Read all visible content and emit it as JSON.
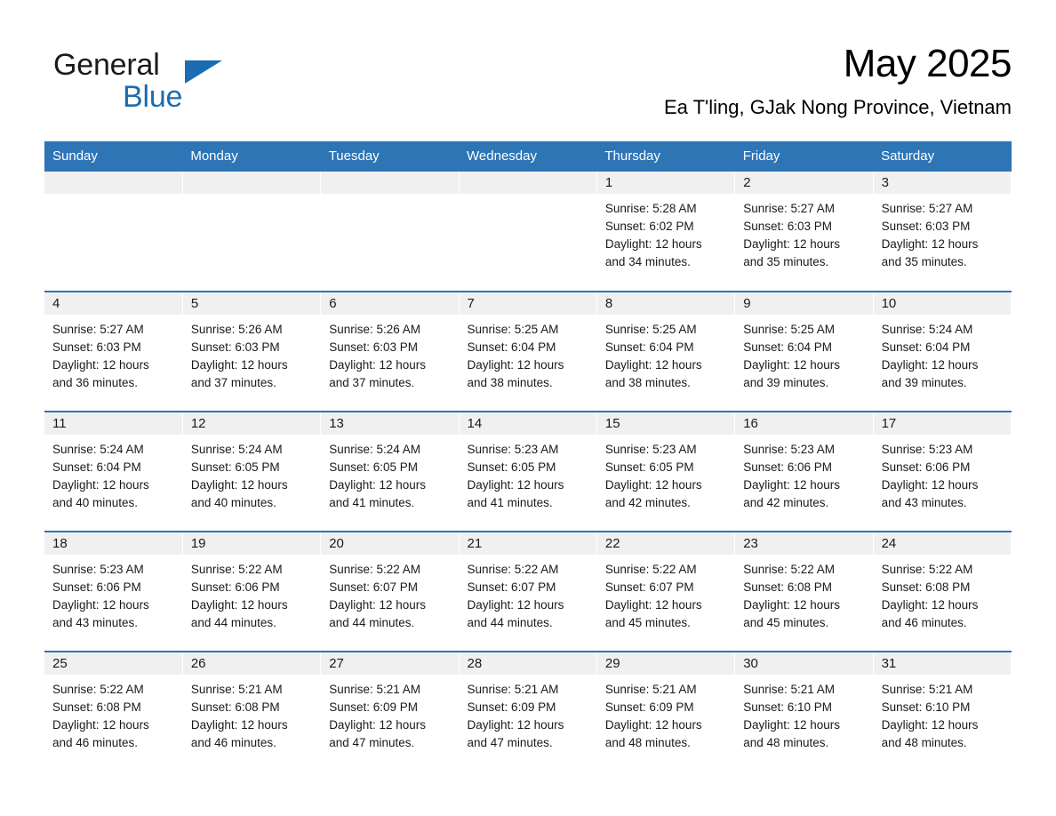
{
  "brand": {
    "name_part1": "General",
    "name_part2": "Blue",
    "triangle_icon": "triangle-right-icon",
    "accent_color": "#1b6cb0"
  },
  "header": {
    "title": "May 2025",
    "subtitle": "Ea T'ling, GJak Nong Province, Vietnam"
  },
  "calendar": {
    "header_bg": "#2e75b6",
    "daycell_header_bg": "#f0f0f0",
    "weekday_headers": [
      "Sunday",
      "Monday",
      "Tuesday",
      "Wednesday",
      "Thursday",
      "Friday",
      "Saturday"
    ],
    "weeks": [
      [
        {
          "day": "",
          "empty": true,
          "sunrise": "",
          "sunset": "",
          "daylight_line1": "",
          "daylight_line2": ""
        },
        {
          "day": "",
          "empty": true,
          "sunrise": "",
          "sunset": "",
          "daylight_line1": "",
          "daylight_line2": ""
        },
        {
          "day": "",
          "empty": true,
          "sunrise": "",
          "sunset": "",
          "daylight_line1": "",
          "daylight_line2": ""
        },
        {
          "day": "",
          "empty": true,
          "sunrise": "",
          "sunset": "",
          "daylight_line1": "",
          "daylight_line2": ""
        },
        {
          "day": "1",
          "empty": false,
          "sunrise": "Sunrise: 5:28 AM",
          "sunset": "Sunset: 6:02 PM",
          "daylight_line1": "Daylight: 12 hours",
          "daylight_line2": "and 34 minutes."
        },
        {
          "day": "2",
          "empty": false,
          "sunrise": "Sunrise: 5:27 AM",
          "sunset": "Sunset: 6:03 PM",
          "daylight_line1": "Daylight: 12 hours",
          "daylight_line2": "and 35 minutes."
        },
        {
          "day": "3",
          "empty": false,
          "sunrise": "Sunrise: 5:27 AM",
          "sunset": "Sunset: 6:03 PM",
          "daylight_line1": "Daylight: 12 hours",
          "daylight_line2": "and 35 minutes."
        }
      ],
      [
        {
          "day": "4",
          "empty": false,
          "sunrise": "Sunrise: 5:27 AM",
          "sunset": "Sunset: 6:03 PM",
          "daylight_line1": "Daylight: 12 hours",
          "daylight_line2": "and 36 minutes."
        },
        {
          "day": "5",
          "empty": false,
          "sunrise": "Sunrise: 5:26 AM",
          "sunset": "Sunset: 6:03 PM",
          "daylight_line1": "Daylight: 12 hours",
          "daylight_line2": "and 37 minutes."
        },
        {
          "day": "6",
          "empty": false,
          "sunrise": "Sunrise: 5:26 AM",
          "sunset": "Sunset: 6:03 PM",
          "daylight_line1": "Daylight: 12 hours",
          "daylight_line2": "and 37 minutes."
        },
        {
          "day": "7",
          "empty": false,
          "sunrise": "Sunrise: 5:25 AM",
          "sunset": "Sunset: 6:04 PM",
          "daylight_line1": "Daylight: 12 hours",
          "daylight_line2": "and 38 minutes."
        },
        {
          "day": "8",
          "empty": false,
          "sunrise": "Sunrise: 5:25 AM",
          "sunset": "Sunset: 6:04 PM",
          "daylight_line1": "Daylight: 12 hours",
          "daylight_line2": "and 38 minutes."
        },
        {
          "day": "9",
          "empty": false,
          "sunrise": "Sunrise: 5:25 AM",
          "sunset": "Sunset: 6:04 PM",
          "daylight_line1": "Daylight: 12 hours",
          "daylight_line2": "and 39 minutes."
        },
        {
          "day": "10",
          "empty": false,
          "sunrise": "Sunrise: 5:24 AM",
          "sunset": "Sunset: 6:04 PM",
          "daylight_line1": "Daylight: 12 hours",
          "daylight_line2": "and 39 minutes."
        }
      ],
      [
        {
          "day": "11",
          "empty": false,
          "sunrise": "Sunrise: 5:24 AM",
          "sunset": "Sunset: 6:04 PM",
          "daylight_line1": "Daylight: 12 hours",
          "daylight_line2": "and 40 minutes."
        },
        {
          "day": "12",
          "empty": false,
          "sunrise": "Sunrise: 5:24 AM",
          "sunset": "Sunset: 6:05 PM",
          "daylight_line1": "Daylight: 12 hours",
          "daylight_line2": "and 40 minutes."
        },
        {
          "day": "13",
          "empty": false,
          "sunrise": "Sunrise: 5:24 AM",
          "sunset": "Sunset: 6:05 PM",
          "daylight_line1": "Daylight: 12 hours",
          "daylight_line2": "and 41 minutes."
        },
        {
          "day": "14",
          "empty": false,
          "sunrise": "Sunrise: 5:23 AM",
          "sunset": "Sunset: 6:05 PM",
          "daylight_line1": "Daylight: 12 hours",
          "daylight_line2": "and 41 minutes."
        },
        {
          "day": "15",
          "empty": false,
          "sunrise": "Sunrise: 5:23 AM",
          "sunset": "Sunset: 6:05 PM",
          "daylight_line1": "Daylight: 12 hours",
          "daylight_line2": "and 42 minutes."
        },
        {
          "day": "16",
          "empty": false,
          "sunrise": "Sunrise: 5:23 AM",
          "sunset": "Sunset: 6:06 PM",
          "daylight_line1": "Daylight: 12 hours",
          "daylight_line2": "and 42 minutes."
        },
        {
          "day": "17",
          "empty": false,
          "sunrise": "Sunrise: 5:23 AM",
          "sunset": "Sunset: 6:06 PM",
          "daylight_line1": "Daylight: 12 hours",
          "daylight_line2": "and 43 minutes."
        }
      ],
      [
        {
          "day": "18",
          "empty": false,
          "sunrise": "Sunrise: 5:23 AM",
          "sunset": "Sunset: 6:06 PM",
          "daylight_line1": "Daylight: 12 hours",
          "daylight_line2": "and 43 minutes."
        },
        {
          "day": "19",
          "empty": false,
          "sunrise": "Sunrise: 5:22 AM",
          "sunset": "Sunset: 6:06 PM",
          "daylight_line1": "Daylight: 12 hours",
          "daylight_line2": "and 44 minutes."
        },
        {
          "day": "20",
          "empty": false,
          "sunrise": "Sunrise: 5:22 AM",
          "sunset": "Sunset: 6:07 PM",
          "daylight_line1": "Daylight: 12 hours",
          "daylight_line2": "and 44 minutes."
        },
        {
          "day": "21",
          "empty": false,
          "sunrise": "Sunrise: 5:22 AM",
          "sunset": "Sunset: 6:07 PM",
          "daylight_line1": "Daylight: 12 hours",
          "daylight_line2": "and 44 minutes."
        },
        {
          "day": "22",
          "empty": false,
          "sunrise": "Sunrise: 5:22 AM",
          "sunset": "Sunset: 6:07 PM",
          "daylight_line1": "Daylight: 12 hours",
          "daylight_line2": "and 45 minutes."
        },
        {
          "day": "23",
          "empty": false,
          "sunrise": "Sunrise: 5:22 AM",
          "sunset": "Sunset: 6:08 PM",
          "daylight_line1": "Daylight: 12 hours",
          "daylight_line2": "and 45 minutes."
        },
        {
          "day": "24",
          "empty": false,
          "sunrise": "Sunrise: 5:22 AM",
          "sunset": "Sunset: 6:08 PM",
          "daylight_line1": "Daylight: 12 hours",
          "daylight_line2": "and 46 minutes."
        }
      ],
      [
        {
          "day": "25",
          "empty": false,
          "sunrise": "Sunrise: 5:22 AM",
          "sunset": "Sunset: 6:08 PM",
          "daylight_line1": "Daylight: 12 hours",
          "daylight_line2": "and 46 minutes."
        },
        {
          "day": "26",
          "empty": false,
          "sunrise": "Sunrise: 5:21 AM",
          "sunset": "Sunset: 6:08 PM",
          "daylight_line1": "Daylight: 12 hours",
          "daylight_line2": "and 46 minutes."
        },
        {
          "day": "27",
          "empty": false,
          "sunrise": "Sunrise: 5:21 AM",
          "sunset": "Sunset: 6:09 PM",
          "daylight_line1": "Daylight: 12 hours",
          "daylight_line2": "and 47 minutes."
        },
        {
          "day": "28",
          "empty": false,
          "sunrise": "Sunrise: 5:21 AM",
          "sunset": "Sunset: 6:09 PM",
          "daylight_line1": "Daylight: 12 hours",
          "daylight_line2": "and 47 minutes."
        },
        {
          "day": "29",
          "empty": false,
          "sunrise": "Sunrise: 5:21 AM",
          "sunset": "Sunset: 6:09 PM",
          "daylight_line1": "Daylight: 12 hours",
          "daylight_line2": "and 48 minutes."
        },
        {
          "day": "30",
          "empty": false,
          "sunrise": "Sunrise: 5:21 AM",
          "sunset": "Sunset: 6:10 PM",
          "daylight_line1": "Daylight: 12 hours",
          "daylight_line2": "and 48 minutes."
        },
        {
          "day": "31",
          "empty": false,
          "sunrise": "Sunrise: 5:21 AM",
          "sunset": "Sunset: 6:10 PM",
          "daylight_line1": "Daylight: 12 hours",
          "daylight_line2": "and 48 minutes."
        }
      ]
    ]
  }
}
